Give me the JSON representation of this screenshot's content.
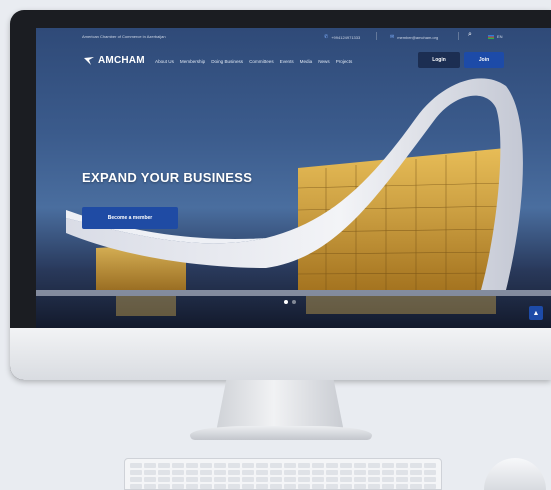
{
  "topbar": {
    "org_text": "American Chamber of Commerce in Azerbaijan",
    "phone": "+994124971333",
    "email": "member@amcham.org",
    "language": "EN"
  },
  "nav": {
    "logo_text": "AMCHAM",
    "items": [
      "About Us",
      "Membership",
      "Doing Business",
      "Committees",
      "Events",
      "Media",
      "News",
      "Projects"
    ],
    "login_label": "Login",
    "join_label": "Join"
  },
  "hero": {
    "headline": "EXPAND YOUR BUSINESS",
    "cta_label": "Become a member",
    "slide_count": 2,
    "active_slide": 1
  },
  "icons": {
    "phone": "phone-icon",
    "email": "email-icon",
    "search": "search-icon",
    "flag": "flag-icon",
    "scroll_top": "chevron-up-icon"
  },
  "colors": {
    "primary_button": "#1d4ba8",
    "login_button": "#1c2e52",
    "sky": "#3b5b8c"
  }
}
